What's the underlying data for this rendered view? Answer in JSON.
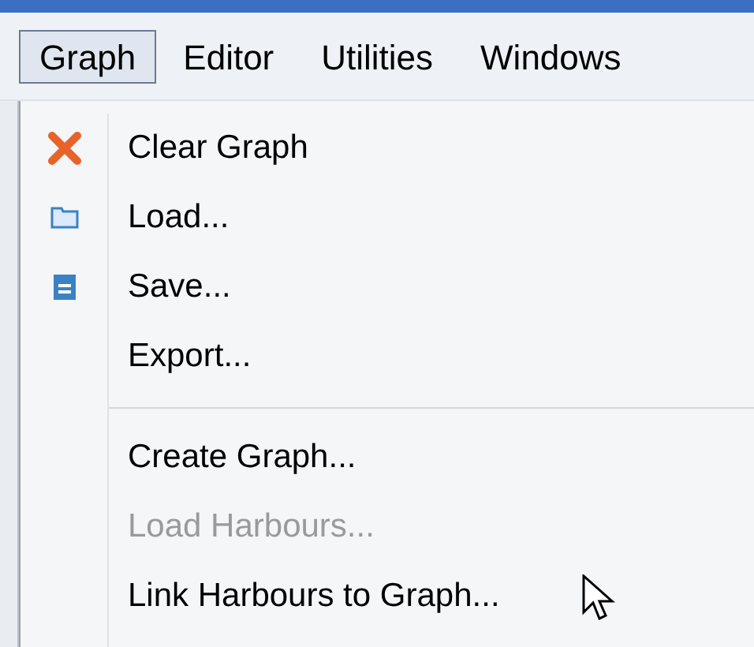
{
  "menu_bar": [
    {
      "label": "Graph",
      "selected": true
    },
    {
      "label": "Editor",
      "selected": false
    },
    {
      "label": "Utilities",
      "selected": false
    },
    {
      "label": "Windows",
      "selected": false
    }
  ],
  "menu": [
    {
      "kind": "cross",
      "label": "Clear Graph",
      "disabled": false
    },
    {
      "kind": "folder",
      "label": "Load...",
      "disabled": false
    },
    {
      "kind": "disk",
      "label": "Save...",
      "disabled": false
    },
    {
      "kind": "plain",
      "label": "Export...",
      "disabled": false
    },
    {
      "kind": "separator"
    },
    {
      "kind": "plain",
      "label": "Create Graph...",
      "disabled": false
    },
    {
      "kind": "plain",
      "label": "Load Harbours...",
      "disabled": true
    },
    {
      "kind": "plain",
      "label": "Link Harbours to Graph...",
      "disabled": false
    }
  ]
}
